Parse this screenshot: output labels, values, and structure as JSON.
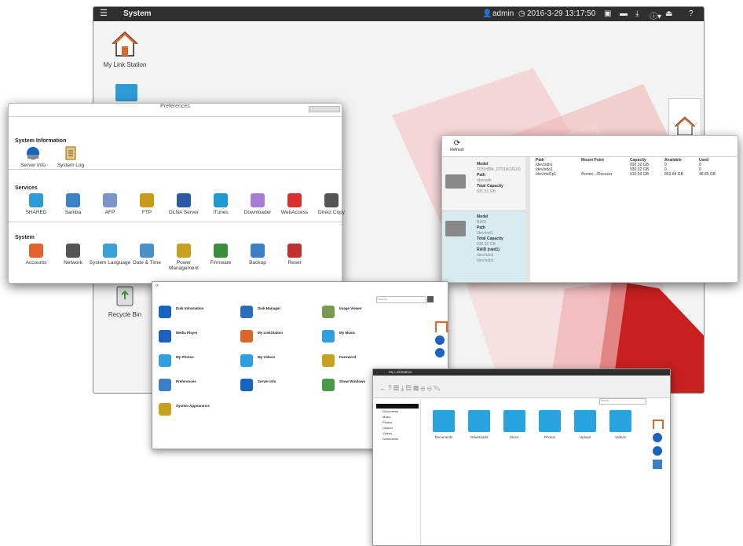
{
  "desktop": {
    "menu_icon": "hamburger-icon",
    "title": "System",
    "user": "admin",
    "datetime": "2016-3-29 13:17:50",
    "icons": [
      {
        "label": "My Link Station",
        "icon": "home-icon"
      },
      {
        "label": "Recycle Bin",
        "icon": "recycle-bin-icon"
      }
    ],
    "help": "?",
    "info": "ⓘ▾"
  },
  "preferences": {
    "title": "Preferences",
    "sections": [
      {
        "title": "System Information",
        "items": [
          {
            "label": "Server Info",
            "icon": "server-info-icon",
            "color": "#1565c0"
          },
          {
            "label": "System Log",
            "icon": "system-log-icon",
            "color": "#c8a14a"
          }
        ]
      },
      {
        "title": "Services",
        "items": [
          {
            "label": "SHARED",
            "icon": "shared-icon",
            "color": "#2e9ad6"
          },
          {
            "label": "Samba",
            "icon": "samba-icon",
            "color": "#3b83c4"
          },
          {
            "label": "AFP",
            "icon": "afp-icon",
            "color": "#7c94c8"
          },
          {
            "label": "FTP",
            "icon": "ftp-icon",
            "color": "#c89a1c"
          },
          {
            "label": "DLNA Server",
            "icon": "dlna-server-icon",
            "color": "#2b5aa8"
          },
          {
            "label": "iTunes",
            "icon": "itunes-icon",
            "color": "#1f9ad1"
          },
          {
            "label": "Downloader",
            "icon": "downloader-icon",
            "color": "#a87bd6"
          },
          {
            "label": "WebAccess",
            "icon": "webaccess-icon",
            "color": "#d9302b"
          },
          {
            "label": "Direct Copy",
            "icon": "direct-copy-icon",
            "color": "#555555"
          }
        ]
      },
      {
        "title": "System",
        "items": [
          {
            "label": "Accounts",
            "icon": "accounts-icon",
            "color": "#e2622b"
          },
          {
            "label": "Network",
            "icon": "network-icon",
            "color": "#555555"
          },
          {
            "label": "System Language",
            "icon": "system-language-icon",
            "color": "#3aa0d8"
          },
          {
            "label": "Date & Time",
            "icon": "date-time-icon",
            "color": "#4a8fc8"
          },
          {
            "label": "Power Management",
            "icon": "power-management-icon",
            "color": "#c8a020"
          },
          {
            "label": "Firmware",
            "icon": "firmware-icon",
            "color": "#3b8f3b"
          },
          {
            "label": "Backup",
            "icon": "backup-icon",
            "color": "#3d7fc6"
          },
          {
            "label": "Reset",
            "icon": "reset-icon",
            "color": "#c03030"
          }
        ]
      }
    ]
  },
  "storage": {
    "refresh_label": "Refresh",
    "disks": [
      {
        "model_label": "Model",
        "model": "TOSHIBA_DT01ACA100",
        "path_label": "Path",
        "path": "/dev/sdb",
        "cap_label": "Total Capacity",
        "capacity": "931.51 GB"
      },
      {
        "model_label": "Model",
        "model": "RAID",
        "path_label": "Path",
        "path": "/dev/md1",
        "cap_label": "Total Capacity",
        "capacity": "930.32 GB",
        "raid_label": "RAID (raid1)",
        "raid_1": "/dev/sda1",
        "raid_2": "/dev/sdb1"
      }
    ],
    "columns": [
      "Path",
      "Mount Point",
      "Capacity",
      "Available",
      "Used"
    ],
    "rows": [
      [
        "/dev/sdb1",
        "",
        "930.32 GB",
        "0",
        "0"
      ],
      [
        "/dev/sda1",
        "",
        "930.32 GB",
        "0",
        "0"
      ],
      [
        "/dev/md1p1",
        "/home/.../Docuser",
        "915.59 GB",
        "853.68 GB",
        "48.89 GB"
      ]
    ]
  },
  "apps": {
    "search_placeholder": "Search",
    "items": [
      {
        "name": "Disk Information",
        "icon": "disk-info-icon",
        "color": "#1565c0"
      },
      {
        "name": "Disk Manager",
        "icon": "disk-manager-icon",
        "color": "#2a6fb8"
      },
      {
        "name": "Image Viewer",
        "icon": "image-viewer-icon",
        "color": "#7b9a4f"
      },
      {
        "name": "Media Player",
        "icon": "media-player-icon",
        "color": "#1f5fbf"
      },
      {
        "name": "My LinkStation",
        "icon": "my-linkstation-icon",
        "color": "#d9662a"
      },
      {
        "name": "My Music",
        "icon": "my-music-icon",
        "color": "#2ea0e0"
      },
      {
        "name": "My Photos",
        "icon": "my-photos-icon",
        "color": "#2ea0e0"
      },
      {
        "name": "My Videos",
        "icon": "my-videos-icon",
        "color": "#2ea0e0"
      },
      {
        "name": "Password",
        "icon": "password-icon",
        "color": "#c8a020"
      },
      {
        "name": "Preferences",
        "icon": "preferences-icon",
        "color": "#3d7fc6"
      },
      {
        "name": "Server Info",
        "icon": "server-info-icon",
        "color": "#1565c0"
      },
      {
        "name": "Show Windows",
        "icon": "show-windows-icon",
        "color": "#4a9a4a"
      },
      {
        "name": "System Appearance",
        "icon": "system-appearance-icon",
        "color": "#c8a020"
      }
    ]
  },
  "files": {
    "title": "My LinkStation",
    "search_placeholder": "Search",
    "tree": [
      "Documents",
      "Music",
      "Photos",
      "Upload",
      "Videos",
      "Downloads"
    ],
    "folders": [
      {
        "label": "Documents",
        "icon": "documents-folder-icon"
      },
      {
        "label": "Downloads",
        "icon": "downloads-folder-icon"
      },
      {
        "label": "Music",
        "icon": "music-folder-icon"
      },
      {
        "label": "Photos",
        "icon": "photos-folder-icon"
      },
      {
        "label": "Upload",
        "icon": "upload-folder-icon"
      },
      {
        "label": "Videos",
        "icon": "videos-folder-icon"
      }
    ]
  },
  "colors": {
    "topbar": "#2f2f2f",
    "accent_red": "#cc1f1f",
    "folder_blue": "#29a3e0"
  }
}
